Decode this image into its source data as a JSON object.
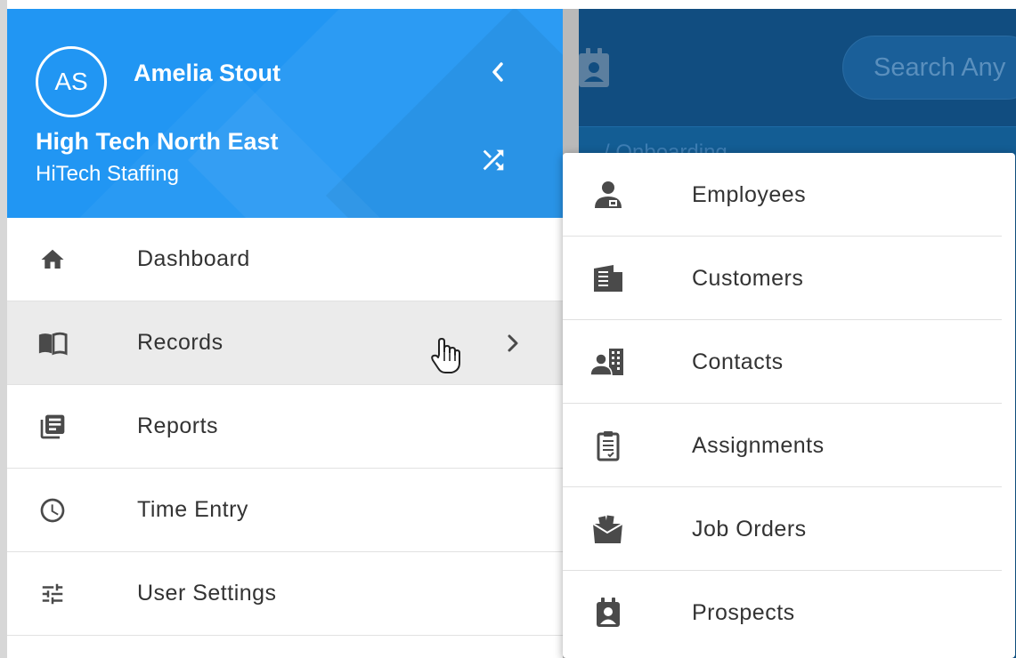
{
  "app": {
    "search_placeholder": "Search Any",
    "breadcrumb": "/ Onboarding"
  },
  "user": {
    "initials": "AS",
    "name": "Amelia Stout",
    "org_name": "High Tech North East",
    "org_sub": "HiTech Staffing"
  },
  "colors": {
    "header_blue": "#2196f3",
    "active_row": "#ebebeb",
    "app_bg": "#135d94",
    "icon_gray": "#4a4a4a"
  },
  "nav": {
    "items": [
      {
        "label": "Dashboard",
        "icon": "home-icon"
      },
      {
        "label": "Records",
        "icon": "book-icon",
        "active": true,
        "has_submenu": true
      },
      {
        "label": "Reports",
        "icon": "reports-icon"
      },
      {
        "label": "Time Entry",
        "icon": "clock-icon"
      },
      {
        "label": "User Settings",
        "icon": "sliders-icon"
      }
    ]
  },
  "submenu": {
    "items": [
      {
        "label": "Employees",
        "icon": "employee-icon"
      },
      {
        "label": "Customers",
        "icon": "building-icon"
      },
      {
        "label": "Contacts",
        "icon": "contacts-icon"
      },
      {
        "label": "Assignments",
        "icon": "clipboard-icon"
      },
      {
        "label": "Job Orders",
        "icon": "job-orders-icon"
      },
      {
        "label": "Prospects",
        "icon": "prospect-icon"
      }
    ]
  }
}
